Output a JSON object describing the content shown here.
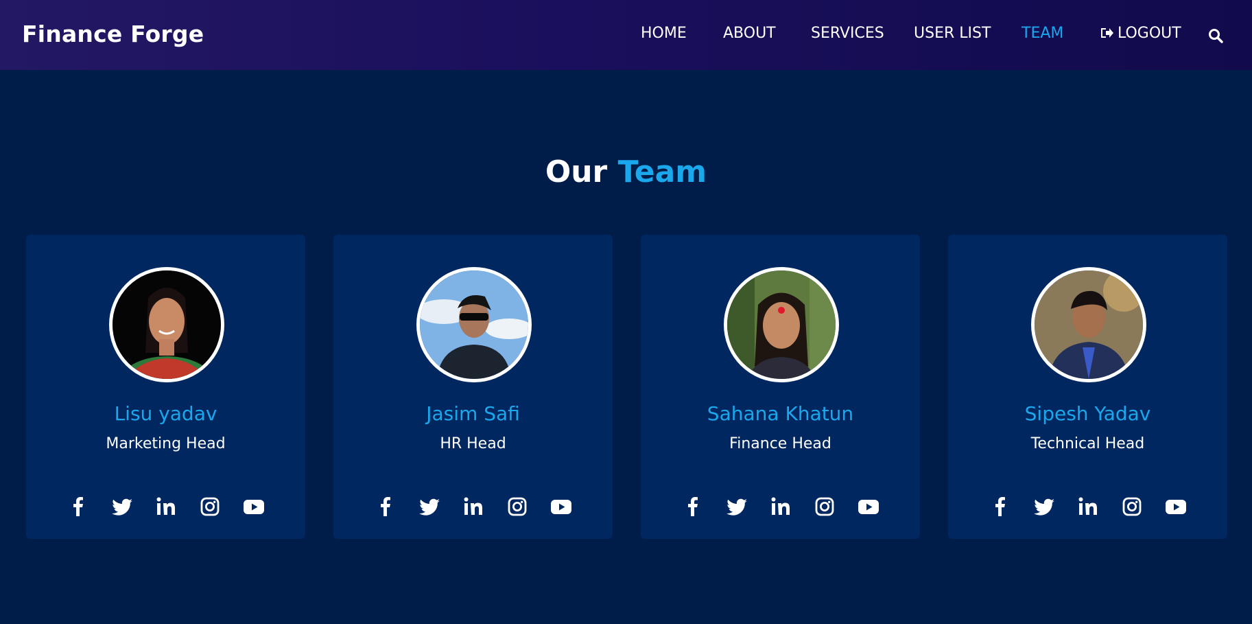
{
  "header": {
    "brand": "Finance Forge",
    "nav": [
      {
        "label": "HOME"
      },
      {
        "label": "ABOUT"
      },
      {
        "label": "SERVICES"
      },
      {
        "label": "USER LIST"
      },
      {
        "label": "TEAM"
      },
      {
        "label": "LOGOUT"
      }
    ],
    "active_nav": "TEAM",
    "search_icon": "search-icon",
    "logout_icon": "sign-out-icon"
  },
  "section": {
    "title_part1": "Our",
    "title_part2": "Team"
  },
  "team": [
    {
      "name": "Lisu yadav",
      "role": "Marketing Head"
    },
    {
      "name": "Jasim Safi",
      "role": "HR Head"
    },
    {
      "name": "Sahana Khatun",
      "role": "Finance Head"
    },
    {
      "name": "Sipesh Yadav",
      "role": "Technical Head"
    }
  ],
  "socials": [
    "facebook-icon",
    "twitter-icon",
    "linkedin-icon",
    "instagram-icon",
    "youtube-icon"
  ],
  "colors": {
    "background": "#001d4a",
    "card": "#00275f",
    "navbar": "#1a0f5c",
    "accent": "#1aa7ec",
    "text": "#ffffff"
  }
}
